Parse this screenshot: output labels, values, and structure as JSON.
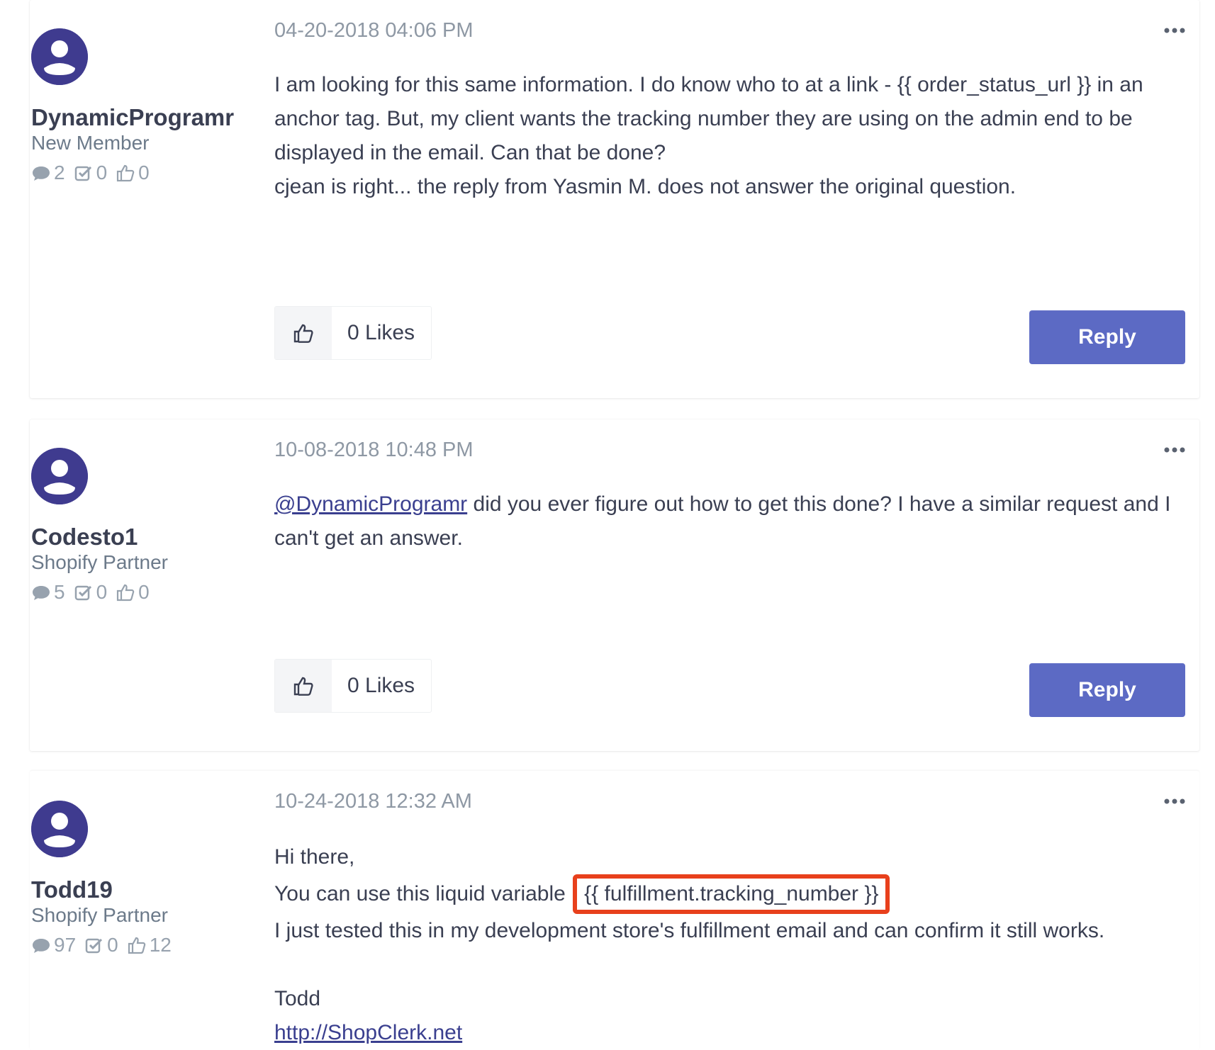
{
  "posts": [
    {
      "timestamp": "04-20-2018 04:06 PM",
      "author": {
        "username": "DynamicProgramr",
        "rank": "New Member",
        "posts": "2",
        "solutions": "0",
        "kudos": "0"
      },
      "body": {
        "line1": "I am looking for this same information.  I do know who to at a link - {{ order_status_url }} in an anchor tag.  But, my client wants the tracking number they are using on the admin end to be displayed in the email.  Can that be done?",
        "line2": "cjean is right... the reply from Yasmin M. does not answer the original question."
      },
      "likes_label": "0 Likes",
      "reply_label": "Reply"
    },
    {
      "timestamp": "10-08-2018 10:48 PM",
      "author": {
        "username": "Codesto1",
        "rank": "Shopify Partner",
        "posts": "5",
        "solutions": "0",
        "kudos": "0"
      },
      "body": {
        "mention": "@DynamicProgramr",
        "text": " did you ever figure out how to get this done?  I have a similar request and I can't get an answer."
      },
      "likes_label": "0 Likes",
      "reply_label": "Reply"
    },
    {
      "timestamp": "10-24-2018 12:32 AM",
      "author": {
        "username": "Todd19",
        "rank": "Shopify Partner",
        "posts": "97",
        "solutions": "0",
        "kudos": "12"
      },
      "body": {
        "greeting": "Hi there,",
        "line_prefix": "You can use this liquid variable ",
        "highlighted_code": "{{ fulfillment.tracking_number }}",
        "line2": "I just tested this in my development store's fulfillment email and can confirm it still works.",
        "signature_name": "Todd",
        "signature_link": "http://ShopClerk.net"
      }
    }
  ],
  "colors": {
    "accent": "#5c6ac4",
    "avatar": "#3f3b8f",
    "highlight_border": "#e8401c"
  },
  "icons": [
    "user-avatar-icon",
    "comment-icon",
    "check-icon",
    "thumbs-up-icon",
    "more-options-icon"
  ]
}
